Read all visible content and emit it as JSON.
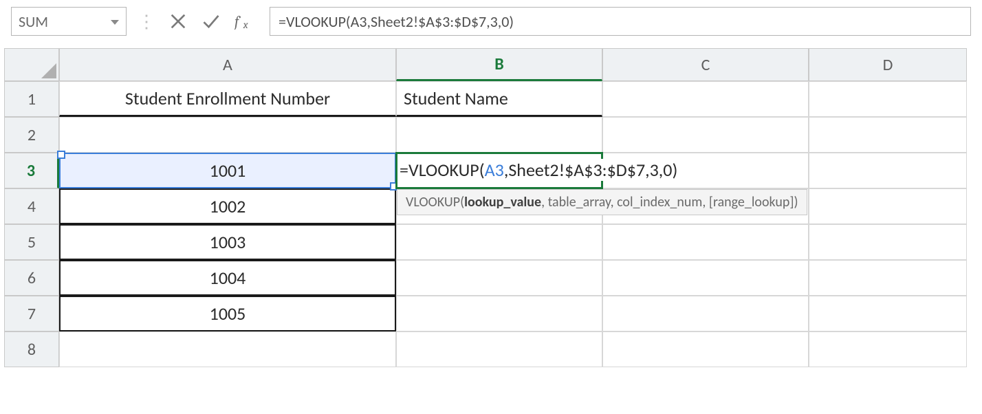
{
  "bar": {
    "name_box": "SUM",
    "formula": "=VLOOKUP(A3,Sheet2!$A$3:$D$7,3,0)"
  },
  "columns": [
    "A",
    "B",
    "C",
    "D"
  ],
  "rows": [
    "1",
    "2",
    "3",
    "4",
    "5",
    "6",
    "7",
    "8"
  ],
  "headers": {
    "A": "Student Enrollment Number",
    "B": "Student Name"
  },
  "columnA": {
    "r3": "1001",
    "r4": "1002",
    "r5": "1003",
    "r6": "1004",
    "r7": "1005"
  },
  "edit": {
    "pre": "=VLOOKUP(",
    "ref": "A3",
    "post": ",Sheet2!$A$3:$D$7,3,0)"
  },
  "tooltip": {
    "fn": "VLOOKUP(",
    "bold": "lookup_value",
    "rest": ", table_array, col_index_num, [range_lookup])"
  }
}
